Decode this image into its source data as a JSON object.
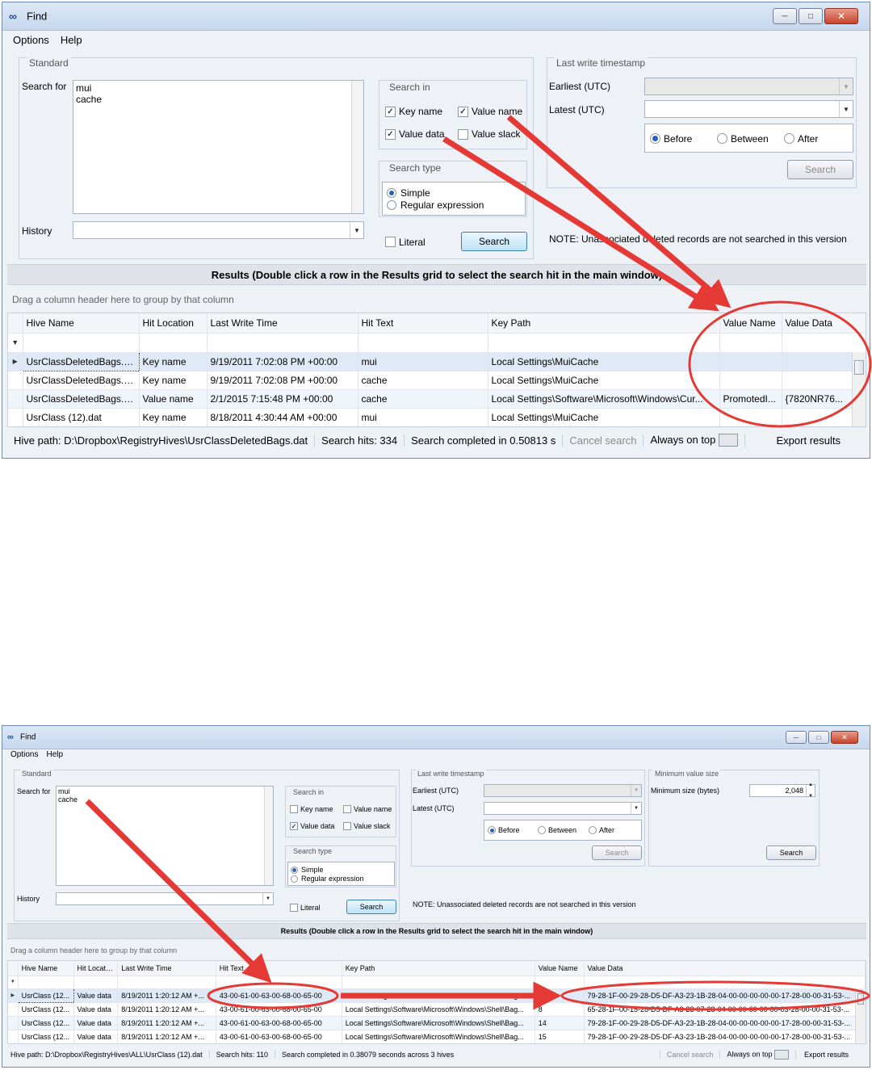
{
  "window": {
    "title": "Find"
  },
  "menu": [
    "Options",
    "Help"
  ],
  "standard": {
    "group_label": "Standard",
    "search_for_label": "Search for",
    "search_terms": [
      "mui",
      "cache"
    ],
    "history_label": "History",
    "history_value": ""
  },
  "search_in": {
    "label": "Search in",
    "key_name": "Key name",
    "value_name": "Value name",
    "value_data": "Value data",
    "value_slack": "Value slack"
  },
  "search_type": {
    "label": "Search type",
    "simple": "Simple",
    "regex": "Regular expression"
  },
  "literal_label": "Literal",
  "search_button": "Search",
  "timestamp": {
    "label": "Last write timestamp",
    "earliest": "Earliest (UTC)",
    "latest": "Latest (UTC)",
    "before": "Before",
    "between": "Between",
    "after": "After",
    "search_button": "Search"
  },
  "min_size": {
    "label": "Minimum value size",
    "field_label": "Minimum size (bytes)",
    "value": "2,048",
    "search_button": "Search"
  },
  "note": "NOTE: Unassociated deleted records are not searched in this version",
  "results_header": "Results (Double click a row in the Results grid to select the search hit in the main window)",
  "group_hint": "Drag a column header here to group by that column",
  "columns1": [
    "Hive Name",
    "Hit Location",
    "Last Write Time",
    "Hit Text",
    "Key Path",
    "Value Name",
    "Value Data"
  ],
  "rows1": [
    [
      "UsrClassDeletedBags.dat",
      "Key name",
      "9/19/2011 7:02:08 PM +00:00",
      "mui",
      "Local Settings\\MuiCache",
      "",
      ""
    ],
    [
      "UsrClassDeletedBags.dat",
      "Key name",
      "9/19/2011 7:02:08 PM +00:00",
      "cache",
      "Local Settings\\MuiCache",
      "",
      ""
    ],
    [
      "UsrClassDeletedBags.dat",
      "Value name",
      "2/1/2015 7:15:48 PM +00:00",
      "cache",
      "Local Settings\\Software\\Microsoft\\Windows\\Cur...",
      "PromotedI...",
      "{7820NR76..."
    ],
    [
      "UsrClass (12).dat",
      "Key name",
      "8/18/2011 4:30:44 AM +00:00",
      "mui",
      "Local Settings\\MuiCache",
      "",
      ""
    ]
  ],
  "status1": {
    "hive_path": "Hive path: D:\\Dropbox\\RegistryHives\\UsrClassDeletedBags.dat",
    "hits": "Search hits: 334",
    "completed": "Search completed in 0.50813 s",
    "cancel": "Cancel search",
    "always_on_top": "Always on top",
    "export": "Export results"
  },
  "columns2": [
    "Hive Name",
    "Hit Location",
    "Last Write Time",
    "Hit Text",
    "Key Path",
    "Value Name",
    "Value Data"
  ],
  "rows2": [
    [
      "UsrClass (12...",
      "Value data",
      "8/19/2011 1:20:12 AM +...",
      "43-00-61-00-63-00-68-00-65-00",
      "Local Settings\\Software\\Microsoft\\Windows\\Shell\\Bag...",
      "",
      "79-28-1F-00-29-28-D5-DF-A3-23-1B-28-04-00-00-00-00-00-17-28-00-00-31-53-..."
    ],
    [
      "UsrClass (12...",
      "Value data",
      "8/19/2011 1:20:12 AM +...",
      "43-00-61-00-63-00-68-00-65-00",
      "Local Settings\\Software\\Microsoft\\Windows\\Shell\\Bag...",
      "8",
      "65-28-1F-00-15-28-D5-DF-A3-23-07-28-04-00-00-00-00-00-03-28-00-00-31-53-..."
    ],
    [
      "UsrClass (12...",
      "Value data",
      "8/19/2011 1:20:12 AM +...",
      "43-00-61-00-63-00-68-00-65-00",
      "Local Settings\\Software\\Microsoft\\Windows\\Shell\\Bag...",
      "14",
      "79-28-1F-00-29-28-D5-DF-A3-23-1B-28-04-00-00-00-00-00-17-28-00-00-31-53-..."
    ],
    [
      "UsrClass (12...",
      "Value data",
      "8/19/2011 1:20:12 AM +...",
      "43-00-61-00-63-00-68-00-65-00",
      "Local Settings\\Software\\Microsoft\\Windows\\Shell\\Bag...",
      "15",
      "79-28-1F-00-29-28-D5-DF-A3-23-1B-28-04-00-00-00-00-00-17-28-00-00-31-53-..."
    ]
  ],
  "status2": {
    "hive_path": "Hive path: D:\\Dropbox\\RegistryHives\\ALL\\UsrClass (12).dat",
    "hits": "Search hits: 110",
    "completed": "Search completed in 0.38079 seconds across 3 hives",
    "cancel": "Cancel search",
    "always_on_top": "Always on top",
    "export": "Export results"
  },
  "colors": {
    "annotation": "#e53935",
    "window_bg": "#eef1f6",
    "primary_button": "#bfe3f9"
  },
  "icons": {
    "app": "find-binoculars-icon",
    "minimize": "minimize-icon",
    "maximize": "maximize-icon",
    "close": "close-icon",
    "dropdown": "chevron-down-icon",
    "row_pointer": "row-pointer-icon",
    "filter_pin": "pin-icon"
  }
}
